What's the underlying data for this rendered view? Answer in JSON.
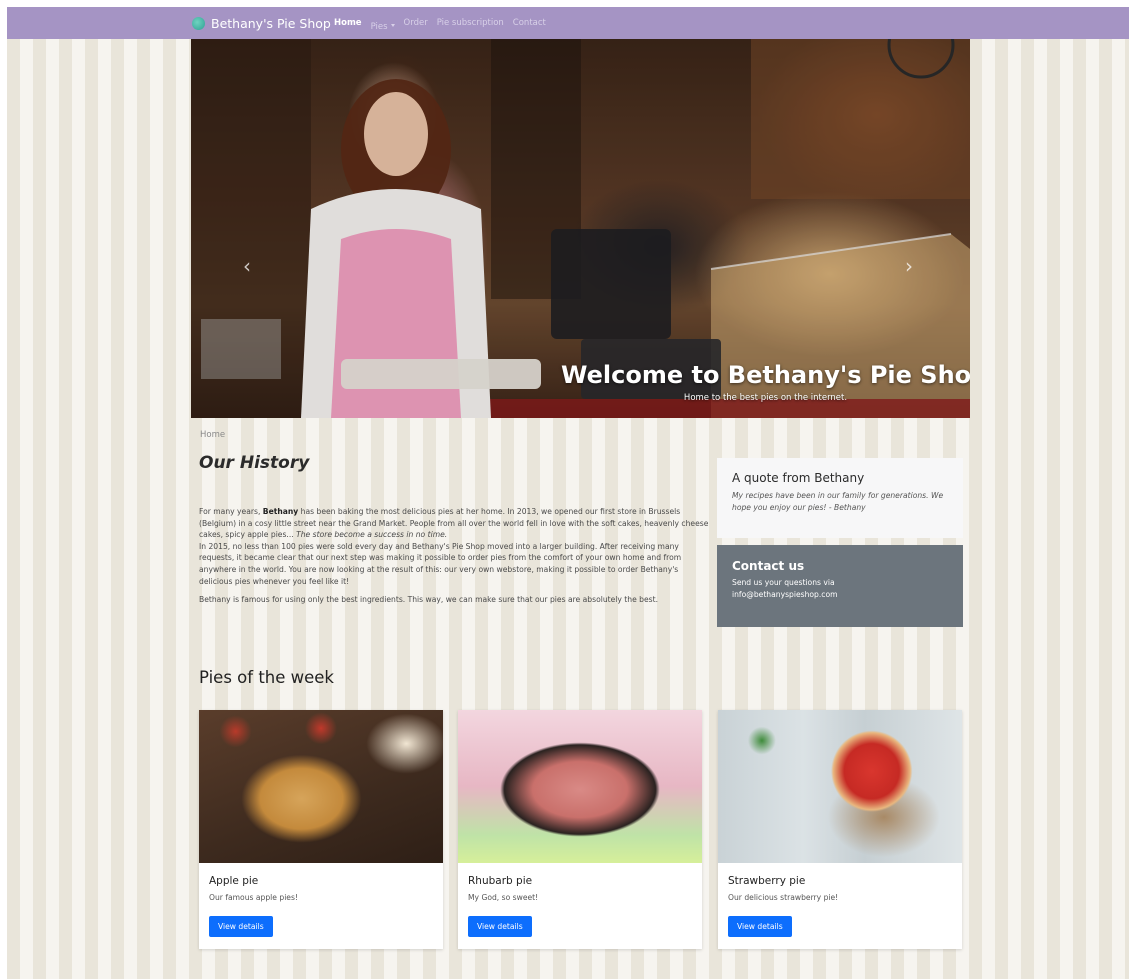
{
  "brand": {
    "name": "Bethany's Pie Shop"
  },
  "nav": {
    "items": [
      {
        "label": "Home"
      },
      {
        "label": "Pies"
      },
      {
        "label": "Order"
      },
      {
        "label": "Pie subscription"
      },
      {
        "label": "Contact"
      }
    ]
  },
  "hero": {
    "title": "Welcome to Bethany's Pie Shop",
    "subtitle": "Home to the best pies on the internet.",
    "slides_count": 3,
    "active_slide": 1
  },
  "breadcrumb": {
    "current": "Home"
  },
  "history": {
    "title": "Our History",
    "p1_a": "For many years, ",
    "p1_b": "Bethany",
    "p1_c": " has been baking the most delicious pies at her home. In 2013, we opened our first store in Brussels (Belgium) in a cosy little street near the Grand Market. People from all over the world fell in love with the soft cakes, heavenly cheese cakes, spicy apple pies... ",
    "p1_i": "The store become a success in no time.",
    "p2": "In 2015, no less than 100 pies were sold every day and Bethany's Pie Shop moved into a larger building. After receiving many requests, it became clear that our next step was making it possible to order pies from the comfort of your own home and from anywhere in the world. You are now looking at the result of this: our very own webstore, making it possible to order Bethany's delicious pies whenever you feel like it!",
    "p3": "Bethany is famous for using only the best ingredients. This way, we can make sure that our pies are absolutely the best."
  },
  "quote": {
    "title": "A quote from Bethany",
    "text": "My recipes have been in our family for generations. We hope you enjoy our pies! - Bethany"
  },
  "contact": {
    "title": "Contact us",
    "line1": "Send us your questions via",
    "email": "info@bethanyspieshop.com"
  },
  "pies_week": {
    "title": "Pies of the week",
    "items": [
      {
        "name": "Apple pie",
        "description": "Our famous apple pies!",
        "button": "View details"
      },
      {
        "name": "Rhubarb pie",
        "description": "My God, so sweet!",
        "button": "View details"
      },
      {
        "name": "Strawberry pie",
        "description": "Our delicious strawberry pie!",
        "button": "View details"
      }
    ]
  },
  "colors": {
    "navbar": "#a594c4",
    "primary_button": "#0d6efd",
    "contact_card": "#6c757d"
  }
}
